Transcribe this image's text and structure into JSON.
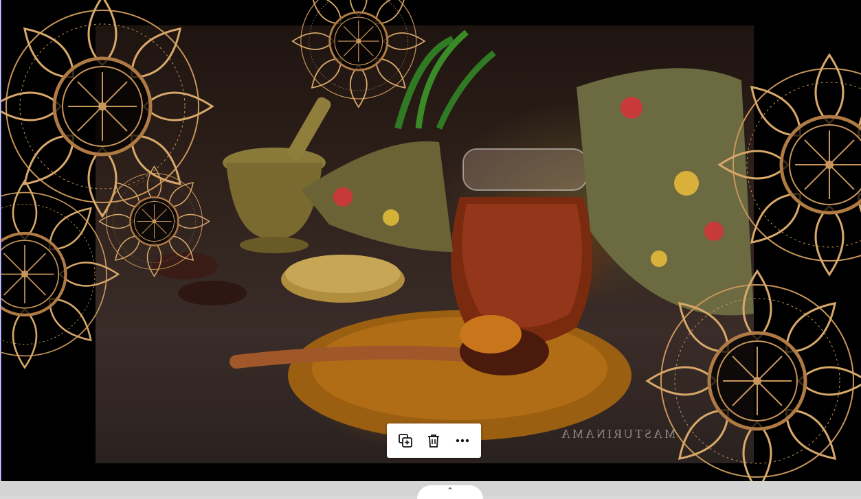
{
  "photo": {
    "watermark_text": "MASTURINAMA"
  },
  "toolbar": {
    "duplicate_icon": "duplicate-icon",
    "delete_icon": "trash-icon",
    "more_icon": "more-icon"
  },
  "bottom": {
    "expand_glyph": "⌃"
  },
  "colors": {
    "gold": "#c8955a",
    "slide_bg": "#000000",
    "selection_border": "#6c5cff"
  }
}
